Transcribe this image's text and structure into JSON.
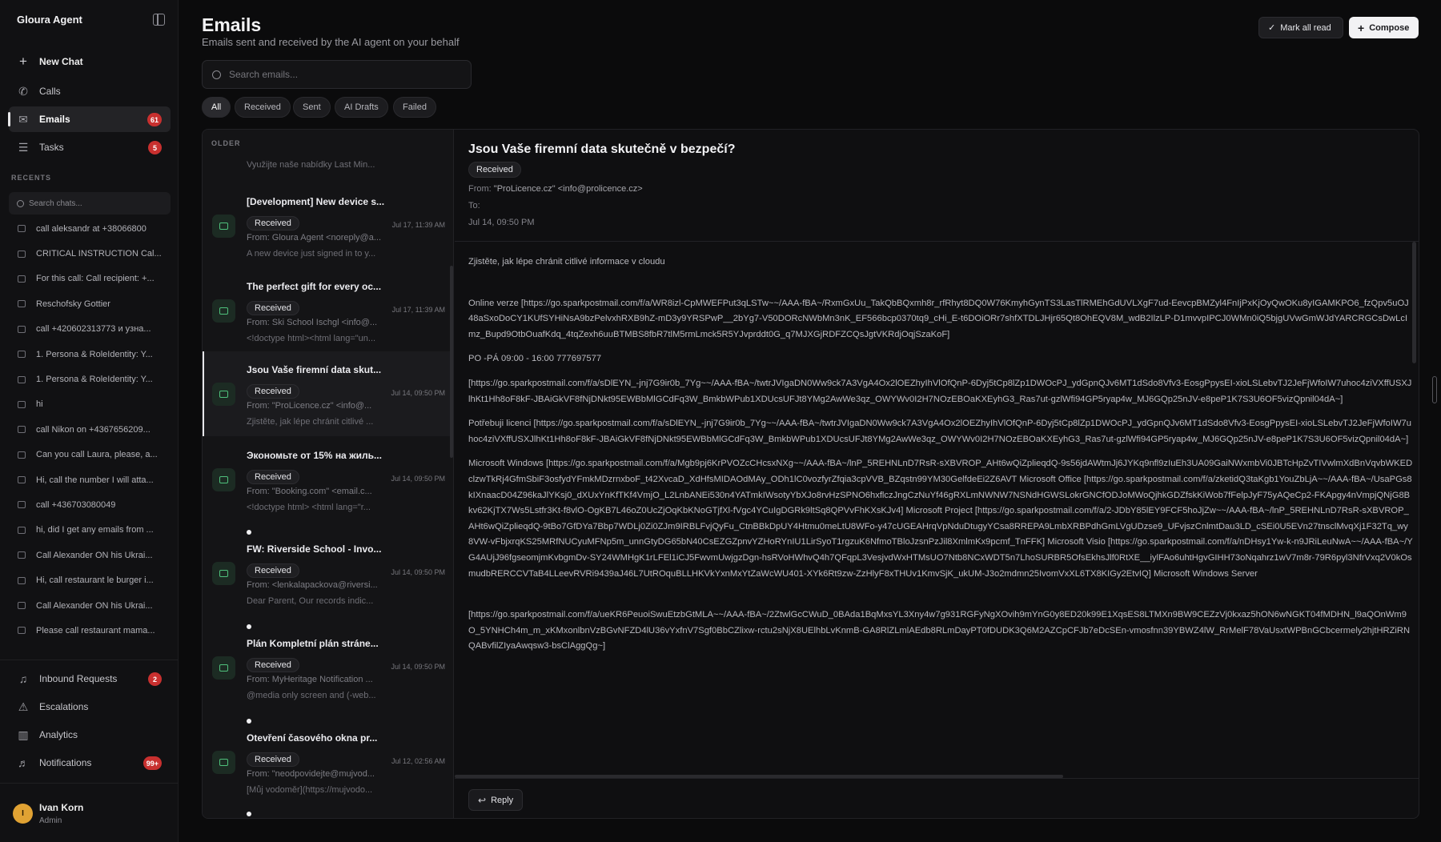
{
  "app": {
    "brand": "Gloura Agent"
  },
  "sidebar": {
    "new_chat": "New Chat",
    "nav": [
      {
        "label": "Calls"
      },
      {
        "label": "Emails",
        "badge": "61"
      },
      {
        "label": "Tasks",
        "badge": "5"
      }
    ],
    "recents_label": "RECENTS",
    "search_placeholder": "Search chats...",
    "recents": [
      "call aleksandr at +38066800",
      "CRITICAL INSTRUCTION Cal...",
      "For this call: Call recipient: +...",
      "Reschofsky Gottier",
      "call +420602313773 и узна...",
      "1. Persona & RoleIdentity: Y...",
      "1. Persona & RoleIdentity: Y...",
      "hi",
      "call Nikon on +4367656209...",
      "Can you call Laura, please, a...",
      "Hi, call the number I will atta...",
      "call +436703080049",
      "hi, did I get any emails from ...",
      "Call Alexander ON his Ukrai...",
      "Hi, call restaurant le burger i...",
      "Call Alexander ON his Ukrai...",
      "Please call restaurant mama..."
    ],
    "bottom_nav": [
      {
        "label": "Inbound Requests",
        "badge": "2"
      },
      {
        "label": "Escalations"
      },
      {
        "label": "Analytics"
      },
      {
        "label": "Notifications",
        "badge": "99+"
      }
    ],
    "user": {
      "initial": "I",
      "name": "Ivan Korn",
      "role": "Admin"
    }
  },
  "header": {
    "title": "Emails",
    "subtitle": "Emails sent and received by the AI agent on your behalf",
    "mark_all_read": "Mark all read",
    "compose": "Compose",
    "search_placeholder": "Search emails..."
  },
  "filters": [
    "All",
    "Received",
    "Sent",
    "AI Drafts",
    "Failed"
  ],
  "list": {
    "group_label": "OLDER",
    "first_preview": "Využijte naše nabídky Last Min...",
    "emails": [
      {
        "subject": "[Development] New device s...",
        "status": "Received",
        "from": "From: Gloura Agent <noreply@a...",
        "preview": "A new device just signed in to y...",
        "date": "Jul 17, 11:39 AM"
      },
      {
        "subject": "The perfect gift for every oc...",
        "status": "Received",
        "from": "From: Ski School Ischgl <info@...",
        "preview": "<!doctype html><html lang=\"un...",
        "date": "Jul 17, 11:39 AM"
      },
      {
        "subject": "Jsou Vaše firemní data skut...",
        "status": "Received",
        "from": "From: \"ProLicence.cz\" <info@...",
        "preview": "Zjistěte, jak lépe chránit citlivé ...",
        "date": "Jul 14, 09:50 PM"
      },
      {
        "subject": "Экономьте от 15% на жиль...",
        "status": "Received",
        "from": "From: \"Booking.com\" <email.c...",
        "preview": "<!doctype html> <html lang=\"r...",
        "date": "Jul 14, 09:50 PM"
      },
      {
        "subject": "FW: Riverside School - Invo...",
        "status": "Received",
        "from": "From: <lenkalapackova@riversi...",
        "preview": "Dear Parent, Our records indic...",
        "date": "Jul 14, 09:50 PM"
      },
      {
        "subject": "Plán Kompletní plán stráne...",
        "status": "Received",
        "from": "From: MyHeritage Notification ...",
        "preview": "@media only screen and (-web...",
        "date": "Jul 14, 09:50 PM"
      },
      {
        "subject": "Otevření časového okna pr...",
        "status": "Received",
        "from": "From: \"neodpovidejte@mujvod...",
        "preview": "[Můj vodoměr](https://mujvodo...",
        "date": "Jul 12, 02:56 AM"
      }
    ]
  },
  "detail": {
    "subject": "Jsou Vaše firemní data skutečně v bezpečí?",
    "status": "Received",
    "from_label": "From:",
    "from_value": "\"ProLicence.cz\" <info@prolicence.cz>",
    "to_label": "To:",
    "date": "Jul 14, 09:50 PM",
    "body": [
      "Zjistěte, jak lépe chránit citlivé informace v cloudu",
      "",
      "Online verze [https://go.sparkpostmail.com/f/a/WR8izl-CpMWEFPut3qLSTw~~/AAA-fBA~/RxmGxUu_TakQbBQxmh8r_rfRhyt8DQ0W76KmyhGynTS3LasTlRMEhGdUVLXgF7ud-EevcpBMZyl4FnIjPxKjOyQwOKu8yIGAMKPO6_fzQpv5uOJ48aSxoDoCY1KUfSYHiNsA9bzPelvxhRXB9hZ-mD3y9YRSPwP__2bYg7-V50DORcNWbMn3nK_EF566bcp0370tq9_cHi_E-t6DOiORr7shfXTDLJHjr65Qt8OhEQV8M_wdB2IlzLP-D1mvvpIPCJ0WMn0iQ5bjgUVwGmWJdYARCRGCsDwLcImz_Bupd9OtbOuafKdq_4tqZexh6uuBTMBS8fbR7tlM5rmLmck5R5YJvprddt0G_q7MJXGjRDFZCQsJgtVKRdjOqjSzaKoF]",
      "PO -PÁ 09:00 - 16:00 777697577",
      "[https://go.sparkpostmail.com/f/a/sDlEYN_-jnj7G9ir0b_7Yg~~/AAA-fBA~/twtrJVIgaDN0Ww9ck7A3VgA4Ox2lOEZhyIhVlOfQnP-6Dyj5tCp8lZp1DWOcPJ_ydGpnQJv6MT1dSdo8Vfv3-EosgPpysEI-xioLSLebvTJ2JeFjWfoIW7uhoc4ziVXffUSXJlhKt1Hh8oF8kF-JBAiGkVF8fNjDNkt95EWBbMlGCdFq3W_BmkbWPub1XDUcsUFJt8YMg2AwWe3qz_OWYWv0I2H7NOzEBOaKXEyhG3_Ras7ut-gzlWfi94GP5ryap4w_MJ6GQp25nJV-e8peP1K7S3U6OF5vizQpnil04dA~]",
      "Potřebuji licenci [https://go.sparkpostmail.com/f/a/sDlEYN_-jnj7G9ir0b_7Yg~~/AAA-fBA~/twtrJVIgaDN0Ww9ck7A3VgA4Ox2lOEZhyIhVlOfQnP-6Dyj5tCp8lZp1DWOcPJ_ydGpnQJv6MT1dSdo8Vfv3-EosgPpysEI-xioLSLebvTJ2JeFjWfoIW7uhoc4ziVXffUSXJlhKt1Hh8oF8kF-JBAiGkVF8fNjDNkt95EWBbMlGCdFq3W_BmkbWPub1XDUcsUFJt8YMg2AwWe3qz_OWYWv0I2H7NOzEBOaKXEyhG3_Ras7ut-gzlWfi94GP5ryap4w_MJ6GQp25nJV-e8peP1K7S3U6OF5vizQpnil04dA~]",
      "Microsoft Windows [https://go.sparkpostmail.com/f/a/Mgb9pj6KrPVOZcCHcsxNXg~~/AAA-fBA~/lnP_5REHNLnD7RsR-sXBVROP_AHt6wQiZplieqdQ-9s56jdAWtmJj6JYKq9nfl9zIuEh3UA09GaiNWxmbVi0JBTcHpZvTIVwlmXdBnVqvbWKEDclzwTkRj4GfmSbiF3osfydYFmkMDzrnxboF_t42XvcaD_XdHfsMIDAOdMAy_ODh1lC0vozfyrZfqia3cpVVB_BZqstn99YM30GelfdeEi2Z6AVT Microsoft Office [https://go.sparkpostmail.com/f/a/zketidQ3taKgb1YouZbLjA~~/AAA-fBA~/UsaPGs8kIXnaacD04Z96kaJlYKsj0_dXUxYnKfTKf4VmjO_L2LnbANEi530n4YATmkIWsotyYbXJo8rvHzSPNO6hxflczJngCzNuYf46gRXLmNWNW7NSNdHGWSLokrGNCfODJoMWoQjhkGDZfskKiWob7fFelpJyF75yAQeCp2-FKApgy4nVmpjQNjG8Bkv62KjTX7Ws5Lstfr3Kt-f8vlO-OgKB7L46oZ0UcZjOqKbKNoGTjfXl-fVgc4YCuIgDGRk9ltSq8QPVvFhKXsKJv4] Microsoft Project [https://go.sparkpostmail.com/f/a/2-JDbY85lEY9FCF5hoJjZw~~/AAA-fBA~/lnP_5REHNLnD7RsR-sXBVROP_AHt6wQiZplieqdQ-9tBo7GfDYa7Bbp7WDLj0Zi0ZJm9IRBLFvjQyFu_CtnBBkDpUY4Htmu0meLtU8WFo-y47cUGEAHrqVpNduDtugyYCsa8RREPA9LmbXRBPdhGmLVgUDzse9_UFvjszCnlmtDau3LD_cSEi0U5EVn27tnsclMvqXj1F32Tq_wy8VW-vFbjxrqKS25MRfNUCyuMFNp5m_unnGtyDG65bN40CsEZGZpnvYZHoRYnIU1LirSyoT1rgzuK6NfmoTBloJzsnPzJil8XmlmKx9pcmf_TnFFK] Microsoft Visio [https://go.sparkpostmail.com/f/a/nDHsy1Yw-k-n9JRiLeuNwA~~/AAA-fBA~/YG4AUjJ96fgseomjmKvbgmDv-SY24WMHgK1rLFEl1iCJ5FwvmUwjgzDgn-hsRVoHWhvQ4h7QFqpL3VesjvdWxHTMsUO7Ntb8NCxWDT5n7LhoSURBR5OfsEkhsJlf0RtXE__iylFAo6uhtHgvGIHH73oNqahrz1wV7m8r-79R6pyl3NfrVxq2V0kOsmudbRERCCVTaB4LLeevRVRi9439aJ46L7UtROquBLLHKVkYxnMxYtZaWcWU401-XYk6Rt9zw-ZzHlyF8xTHUv1KmvSjK_ukUM-J3o2mdmn25IvomVxXL6TX8KIGy2EtvIQ] Microsoft Windows Server",
      "",
      "[https://go.sparkpostmail.com/f/a/ueKR6PeuoiSwuEtzbGtMLA~~/AAA-fBA~/2ZtwlGcCWuD_0BAda1BqMxsYL3Xny4w7g931RGFyNgXOvih9mYnG0y8ED20k99E1XqsES8LTMXn9BW9CEZzVj0kxaz5hON6wNGKT04fMDHN_l9aQOnWm9O_5YNHCh4m_m_xKMxonlbnVzBGvNFZD4lU36vYxfnV7Sgf0BbCZlixw-rctu2sNjX8UElhbLvKnmB-GA8RlZLmlAEdb8RLmDayPT0fDUDK3Q6M2AZCpCFJb7eDcSEn-vmosfnn39YBWZ4lW_RrMelF78VaUsxtWPBnGCbcermely2hjtHRZiRNQABvfilZIyaAwqsw3-bsClAggQg~]"
    ],
    "reply": "Reply"
  }
}
